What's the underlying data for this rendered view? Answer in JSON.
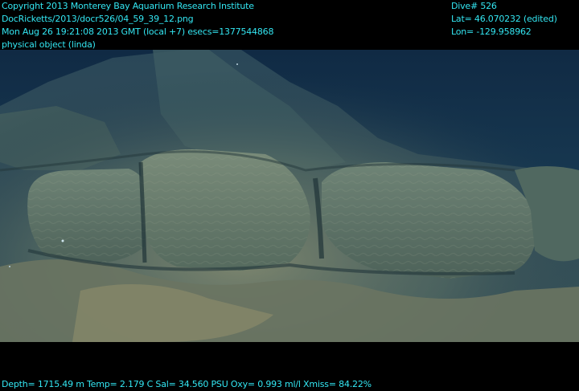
{
  "overlay": {
    "top_left": [
      "Copyright 2013 Monterey Bay Aquarium Research Institute",
      "DocRicketts/2013/docr526/04_59_39_12.png",
      "Mon Aug 26 19:21:08 2013 GMT (local +7)  esecs=1377544868",
      "physical object (linda)"
    ],
    "top_right": [
      "Dive# 526",
      "Lat= 46.070232 (edited)",
      "Lon= -129.958962"
    ],
    "bottom": "Depth= 1715.49 m  Temp= 2.179 C  Sal= 34.560 PSU  Oxy= 0.993 ml/l  Xmiss= 84.22%"
  },
  "colors": {
    "overlay_text": "#33e6f2",
    "water": "#14314a",
    "rock": "#5f7467",
    "sediment": "#7d806a"
  }
}
